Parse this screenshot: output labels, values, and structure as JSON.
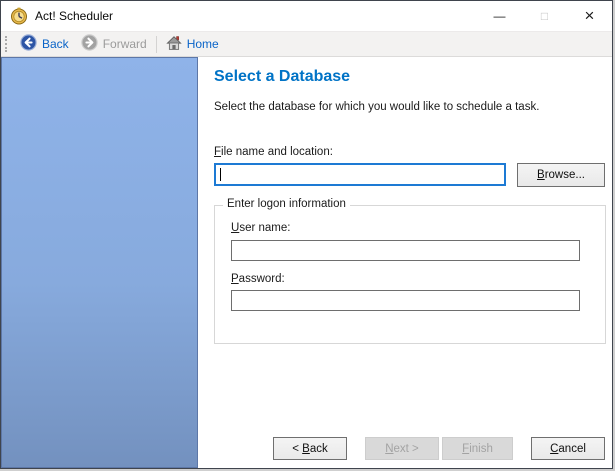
{
  "window": {
    "title": "Act! Scheduler",
    "icons": {
      "app": "clock-icon",
      "minimize": "—",
      "maximize": "□",
      "close": "×"
    }
  },
  "toolbar": {
    "back_label": "Back",
    "forward_label": "Forward",
    "home_label": "Home",
    "back_enabled": true,
    "forward_enabled": false,
    "home_enabled": true
  },
  "main": {
    "heading": "Select a Database",
    "description": "Select the database for which you would like to schedule a task.",
    "file_field": {
      "label_mn": "F",
      "label_rest": "ile name and location:",
      "value": ""
    },
    "browse_button": {
      "mn": "B",
      "rest": "rowse..."
    },
    "logon_group": {
      "title": "Enter logon information",
      "username": {
        "label_mn": "U",
        "label_rest": "ser name:",
        "value": ""
      },
      "password": {
        "label_mn": "P",
        "label_rest": "assword:",
        "value": ""
      }
    }
  },
  "footer": {
    "back_button": {
      "prefix": "< ",
      "mn": "B",
      "rest": "ack",
      "enabled": true
    },
    "next_button": {
      "mn": "N",
      "rest": "ext >",
      "enabled": false
    },
    "finish_button": {
      "mn": "F",
      "rest": "inish",
      "enabled": false
    },
    "cancel_button": {
      "mn": "C",
      "rest": "ancel",
      "enabled": true
    }
  },
  "colors": {
    "heading_blue": "#0073C6",
    "link_blue": "#0A64C8",
    "focus_border": "#1D7AD4",
    "sidebar_top": "#8FB3E9",
    "sidebar_bottom": "#7391BF"
  }
}
